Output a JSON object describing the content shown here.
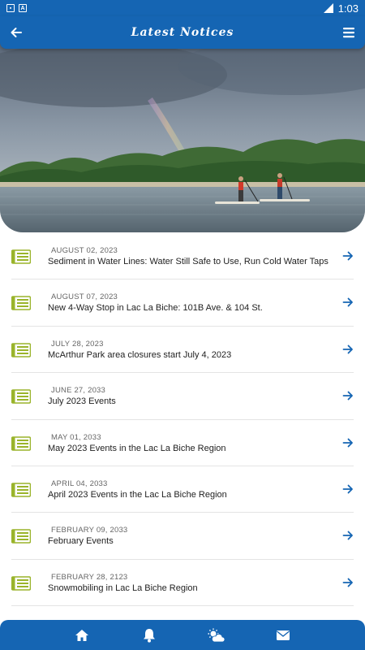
{
  "status_bar": {
    "time": "1:03"
  },
  "app_bar": {
    "title": "Latest Notices"
  },
  "colors": {
    "primary": "#1565b3",
    "icon_green": "#9ab42b",
    "arrow_blue": "#1565b3"
  },
  "notices": [
    {
      "date": "AUGUST 02, 2023",
      "title": "Sediment in Water Lines: Water Still Safe to Use, Run Cold Water Taps"
    },
    {
      "date": "AUGUST 07, 2023",
      "title": "New 4-Way Stop in Lac La Biche: 101B Ave. & 104 St."
    },
    {
      "date": "JULY 28, 2023",
      "title": "McArthur Park area closures start July 4, 2023"
    },
    {
      "date": "JUNE 27, 2033",
      "title": "July 2023 Events"
    },
    {
      "date": "MAY 01, 2033",
      "title": "May 2023 Events in the Lac La Biche Region"
    },
    {
      "date": "APRIL 04, 2033",
      "title": "April 2023 Events in the Lac La Biche Region"
    },
    {
      "date": "FEBRUARY 09, 2033",
      "title": "February Events"
    },
    {
      "date": "FEBRUARY 28, 2123",
      "title": "Snowmobiling in Lac La Biche Region"
    }
  ],
  "bottom_nav": [
    {
      "icon": "home-icon"
    },
    {
      "icon": "bell-icon"
    },
    {
      "icon": "weather-icon"
    },
    {
      "icon": "mail-icon"
    }
  ]
}
